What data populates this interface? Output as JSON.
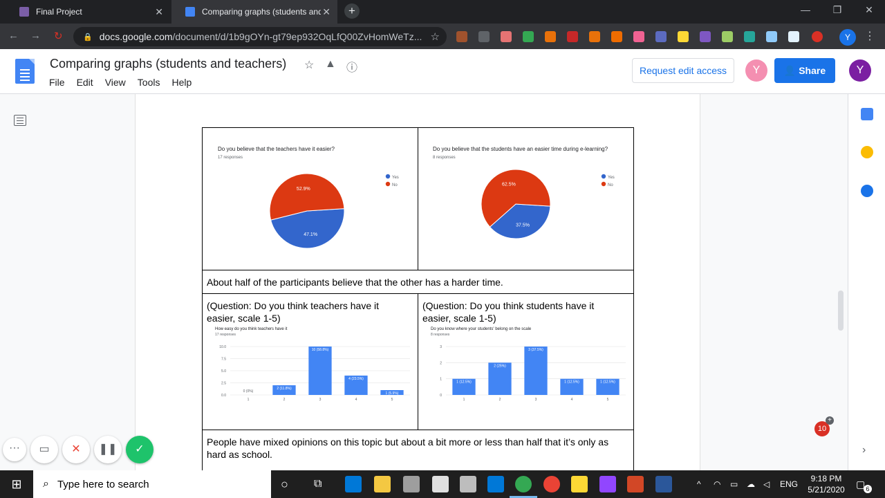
{
  "browser": {
    "tabs": [
      {
        "title": "Final Project",
        "active": false
      },
      {
        "title": "Comparing graphs (students and teachers)",
        "active": true
      }
    ],
    "url_domain": "docs.google.com",
    "url_path": "/document/d/1b9gOYn-gt79ep932OqLfQ00ZvHomWeTz...",
    "profile_initial": "Y"
  },
  "doc": {
    "title": "Comparing graphs (students and teachers)",
    "menu": [
      "File",
      "Edit",
      "View",
      "Tools",
      "Help"
    ],
    "request_edit_label": "Request edit access",
    "share_label": "Share",
    "avatar_initial": "Y",
    "avatar2_initial": "Y",
    "notification_count": "10",
    "table": {
      "summary1": "About half of the participants believe that the other has a harder time.",
      "q1": "(Question: Do you think teachers have it easier, scale 1-5)",
      "q2": "(Question: Do you think students have it easier, scale 1-5)",
      "summary2": "People have mixed opinions on this topic but about a bit more or less than half that it’s only as hard as school."
    }
  },
  "chart_data": [
    {
      "type": "pie",
      "title": "Do you believe that the teachers have it easier?",
      "subtitle": "17 responses",
      "labels": [
        "Yes",
        "No"
      ],
      "values": [
        47.1,
        52.9
      ],
      "value_labels": [
        "47.1%",
        "52.9%"
      ],
      "colors": [
        "#3366cc",
        "#dc3912"
      ],
      "legend": "right"
    },
    {
      "type": "pie",
      "title": "Do you believe that the students have an easier time during e-learning?",
      "subtitle": "8 responses",
      "labels": [
        "Yes",
        "No"
      ],
      "values": [
        37.5,
        62.5
      ],
      "value_labels": [
        "37.5%",
        "62.5%"
      ],
      "colors": [
        "#3366cc",
        "#dc3912"
      ],
      "legend": "right"
    },
    {
      "type": "bar",
      "title": "How easy do you think teachers have it",
      "subtitle": "17 responses",
      "categories": [
        "1",
        "2",
        "3",
        "4",
        "5"
      ],
      "values": [
        0,
        2,
        10,
        4,
        1
      ],
      "value_labels": [
        "0 (0%)",
        "2 (11.8%)",
        "10 (58.8%)",
        "4 (23.5%)",
        "1 (5.9%)"
      ],
      "yticks": [
        "0.0",
        "2.5",
        "5.0",
        "7.5",
        "10.0"
      ],
      "ylim": [
        0,
        10
      ],
      "color": "#4285f4"
    },
    {
      "type": "bar",
      "title": "Do you know where your students' belong on the scale",
      "subtitle": "8 responses",
      "categories": [
        "1",
        "2",
        "3",
        "4",
        "5"
      ],
      "values": [
        1,
        2,
        3,
        1,
        1
      ],
      "value_labels": [
        "1 (12.5%)",
        "2 (25%)",
        "3 (37.5%)",
        "1 (12.5%)",
        "1 (12.5%)"
      ],
      "yticks": [
        "0",
        "1",
        "2",
        "3"
      ],
      "ylim": [
        0,
        3
      ],
      "color": "#4285f4"
    }
  ],
  "taskbar": {
    "search_placeholder": "Type here to search",
    "language": "ENG",
    "time": "9:18 PM",
    "date": "5/21/2020",
    "notification_count": "6"
  }
}
